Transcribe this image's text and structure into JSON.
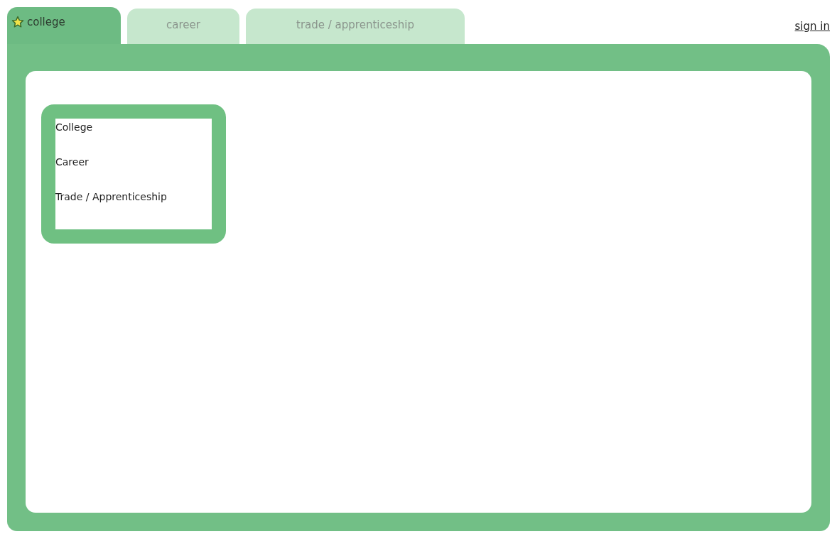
{
  "tabs": [
    {
      "label": "college",
      "selected": true
    },
    {
      "label": "career",
      "selected": false
    },
    {
      "label": "trade / apprenticeship",
      "selected": false
    }
  ],
  "sign_in": "sign in",
  "menu": {
    "items": [
      "College",
      "Career",
      "Trade / Apprenticeship"
    ]
  }
}
